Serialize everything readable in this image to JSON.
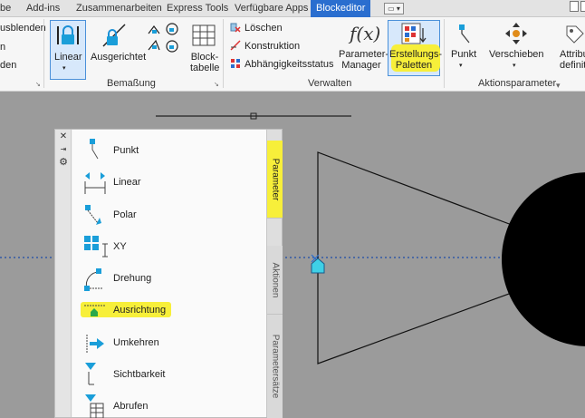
{
  "tabs": [
    "be",
    "Add-ins",
    "Zusammenarbeiten",
    "Express Tools",
    "Verfügbare Apps",
    "Blockeditor"
  ],
  "ribbon": {
    "bemassung": {
      "title": "Bemaßung",
      "small_items": [
        "usblenden",
        "n",
        "den"
      ],
      "linear": "Linear",
      "ausgerichtet": "Ausgerichtet",
      "blocktabelle_line1": "Block-",
      "blocktabelle_line2": "tabelle"
    },
    "verwalten": {
      "title": "Verwalten",
      "loeschen": "Löschen",
      "konstruktion": "Konstruktion",
      "abhaengigkeit": "Abhängigkeitsstatus",
      "param_manager_line1": "Parameter-",
      "param_manager_line2": "Manager",
      "erstellungs_line1": "Erstellungs-",
      "erstellungs_line2": "Paletten"
    },
    "aktionsparameter": {
      "title": "Aktionsparameter",
      "punkt": "Punkt",
      "verschieben": "Verschieben",
      "attrib_line1": "Attribu",
      "attrib_line2": "definiti"
    },
    "icon_fx": "f(x)"
  },
  "palette": {
    "side_tabs": [
      "Parameter",
      "Aktionen",
      "Parametersätze"
    ],
    "items": [
      "Punkt",
      "Linear",
      "Polar",
      "XY",
      "Drehung",
      "Ausrichtung",
      "Umkehren",
      "Sichtbarkeit",
      "Abrufen"
    ]
  },
  "colors": {
    "highlight": "#f7ef3a",
    "accent_blue": "#2a6ecf",
    "grip_cyan": "#3fd0e6"
  }
}
